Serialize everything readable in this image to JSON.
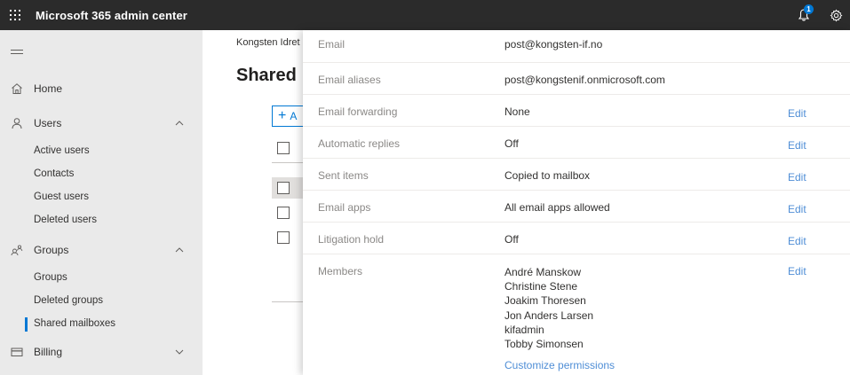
{
  "topbar": {
    "title": "Microsoft 365 admin center",
    "notification_count": "1"
  },
  "sidebar": {
    "items": [
      {
        "label": "Home"
      },
      {
        "label": "Users"
      },
      {
        "label": "Groups"
      },
      {
        "label": "Billing"
      }
    ],
    "users_sub": [
      "Active users",
      "Contacts",
      "Guest users",
      "Deleted users"
    ],
    "groups_sub": [
      "Groups",
      "Deleted groups",
      "Shared mailboxes"
    ]
  },
  "main": {
    "breadcrumb": "Kongsten Idret",
    "title": "Shared",
    "add_label": "A"
  },
  "panel": {
    "rows": [
      {
        "label": "Email",
        "value": "post@kongsten-if.no",
        "edit": ""
      },
      {
        "label": "Email aliases",
        "value": "post@kongstenif.onmicrosoft.com",
        "edit": ""
      },
      {
        "label": "Email forwarding",
        "value": "None",
        "edit": "Edit"
      },
      {
        "label": "Automatic replies",
        "value": "Off",
        "edit": "Edit"
      },
      {
        "label": "Sent items",
        "value": "Copied to mailbox",
        "edit": "Edit"
      },
      {
        "label": "Email apps",
        "value": "All email apps allowed",
        "edit": "Edit"
      },
      {
        "label": "Litigation hold",
        "value": "Off",
        "edit": "Edit"
      }
    ],
    "members_label": "Members",
    "members_edit": "Edit",
    "members": [
      "André Manskow",
      "Christine Stene",
      "Joakim Thoresen",
      "Jon Anders Larsen",
      "kifadmin",
      "Tobby Simonsen"
    ],
    "customize_link": "Customize permissions"
  }
}
